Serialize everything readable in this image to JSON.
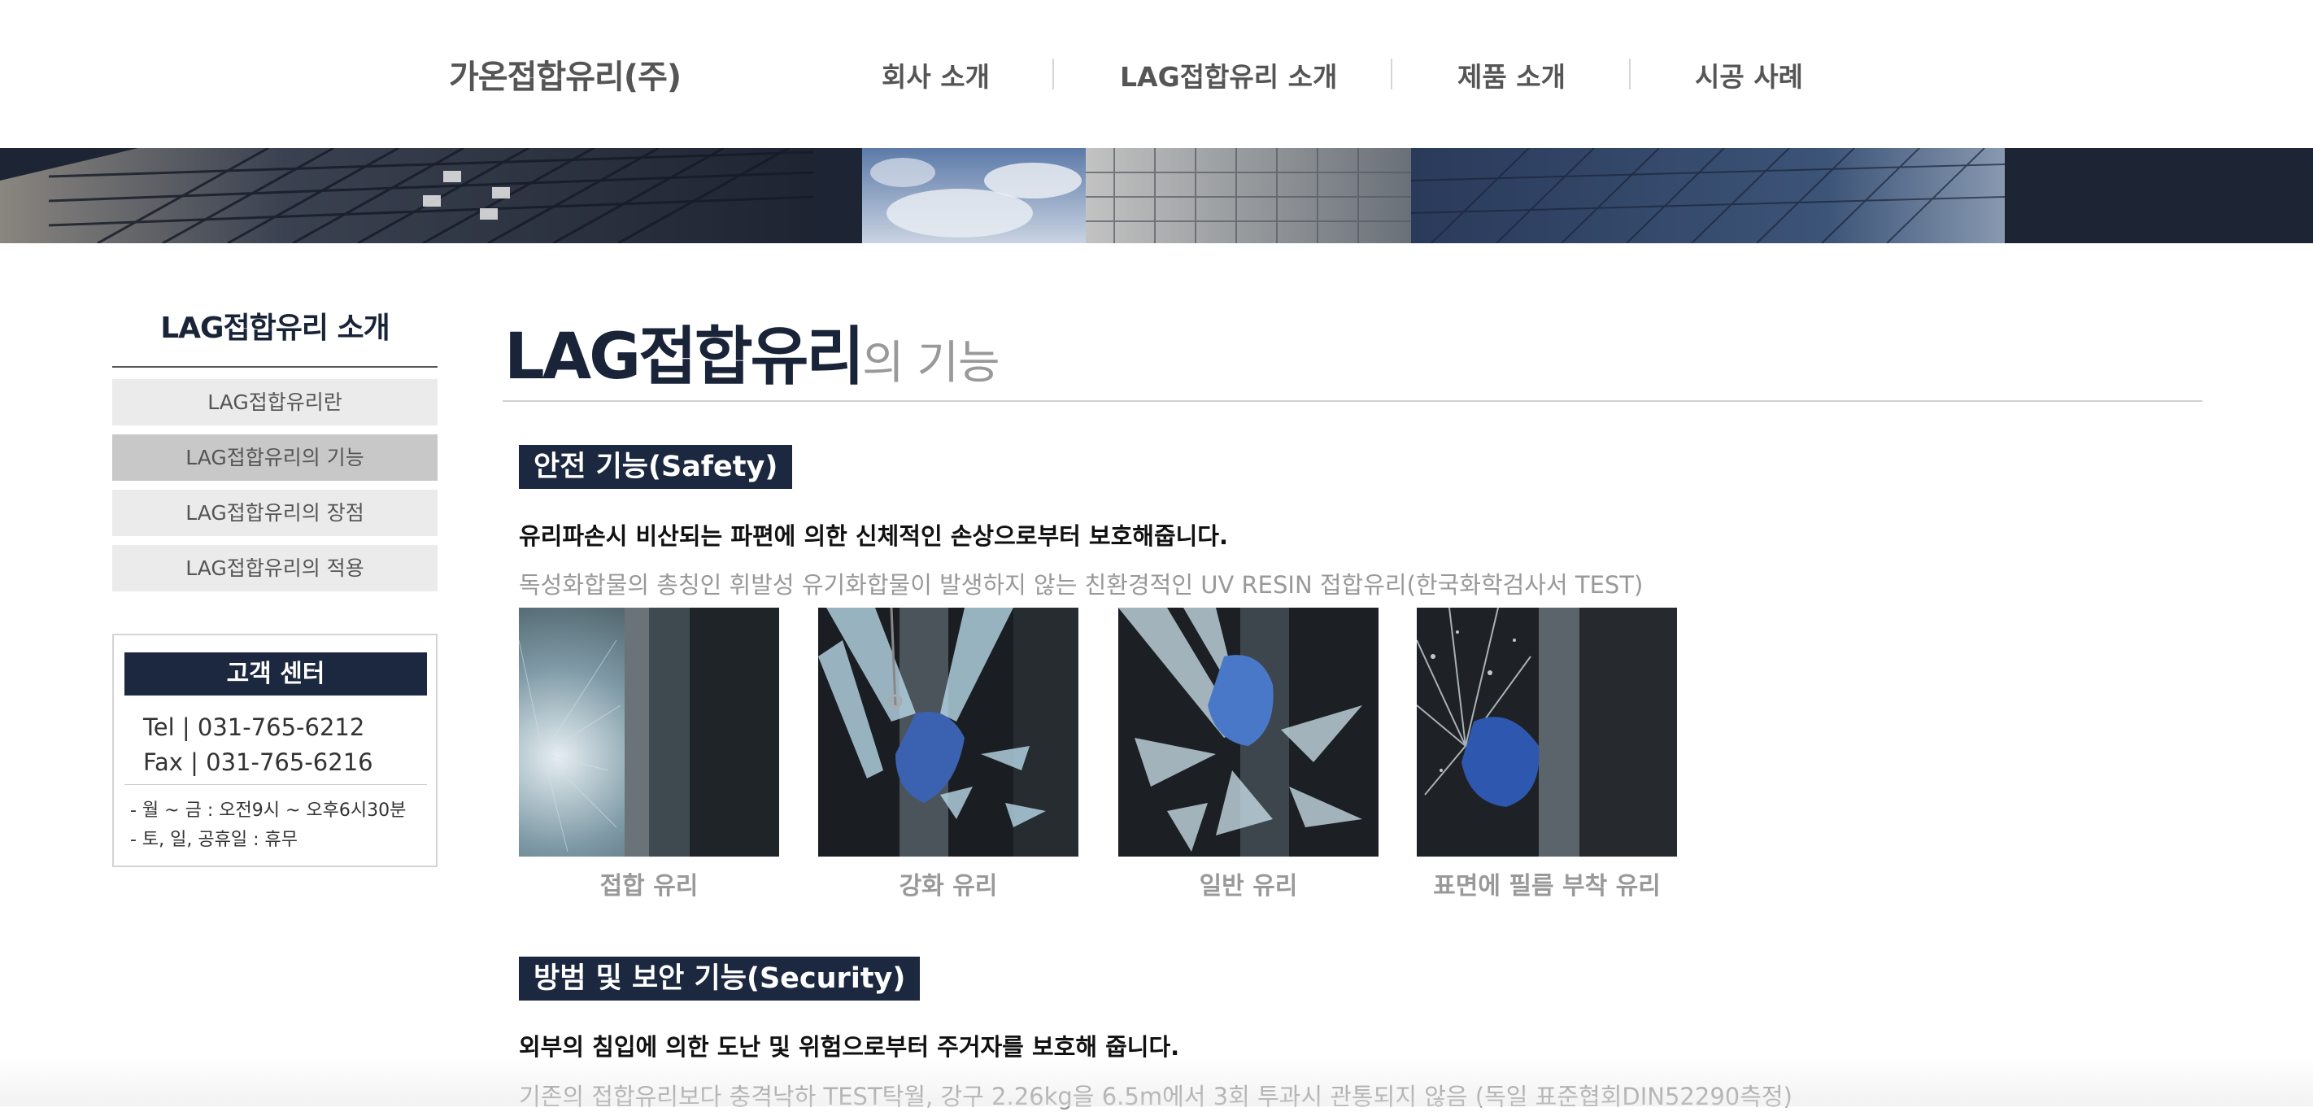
{
  "header": {
    "logo": "가온접합유리(주)",
    "nav": [
      {
        "label": "회사 소개"
      },
      {
        "label": "LAG접합유리 소개"
      },
      {
        "label": "제품 소개"
      },
      {
        "label": "시공 사례"
      }
    ]
  },
  "sidebar": {
    "title": "LAG접합유리 소개",
    "items": [
      {
        "label": "LAG접합유리란",
        "active": false
      },
      {
        "label": "LAG접합유리의 기능",
        "active": true
      },
      {
        "label": "LAG접합유리의 장점",
        "active": false
      },
      {
        "label": "LAG접합유리의 적용",
        "active": false
      }
    ],
    "customer_center": {
      "title": "고객 센터",
      "tel": "Tel  | 031-765-6212",
      "fax": "Fax | 031-765-6216",
      "hours": [
        "- 월 ~ 금 : 오전9시 ~ 오후6시30분",
        "- 토, 일, 공휴일 : 휴무"
      ]
    }
  },
  "main": {
    "title_main": "LAG접합유리",
    "title_sub": "의 기능",
    "sections": [
      {
        "badge": "안전 기능(Safety)",
        "desc": "유리파손시 비산되는 파편에 의한 신체적인 손상으로부터 보호해줍니다.",
        "note": "독성화합물의 총칭인 휘발성 유기화합물이 발생하지 않는 친환경적인 UV RESIN 접합유리(한국화학검사서 TEST)",
        "photos": [
          {
            "caption": "접합 유리"
          },
          {
            "caption": "강화 유리"
          },
          {
            "caption": "일반 유리"
          },
          {
            "caption": "표면에 필름 부착 유리"
          }
        ]
      },
      {
        "badge": "방범 및 보안 기능(Security)",
        "desc": "외부의 침입에 의한 도난 및 위험으로부터 주거자를 보호해 줍니다.",
        "note": "기존의 접합유리보다 충격낙하 TEST탁월, 강구 2.26kg을 6.5m에서 3회 투과시 관통되지 않음 (독일 표준협회DIN52290측정)"
      }
    ]
  },
  "colors": {
    "navy": "#1c2840",
    "title_navy": "#1a2438",
    "grey_text": "#999999",
    "menu_bg": "#ebebeb",
    "menu_active_bg": "#c8c8c8"
  }
}
